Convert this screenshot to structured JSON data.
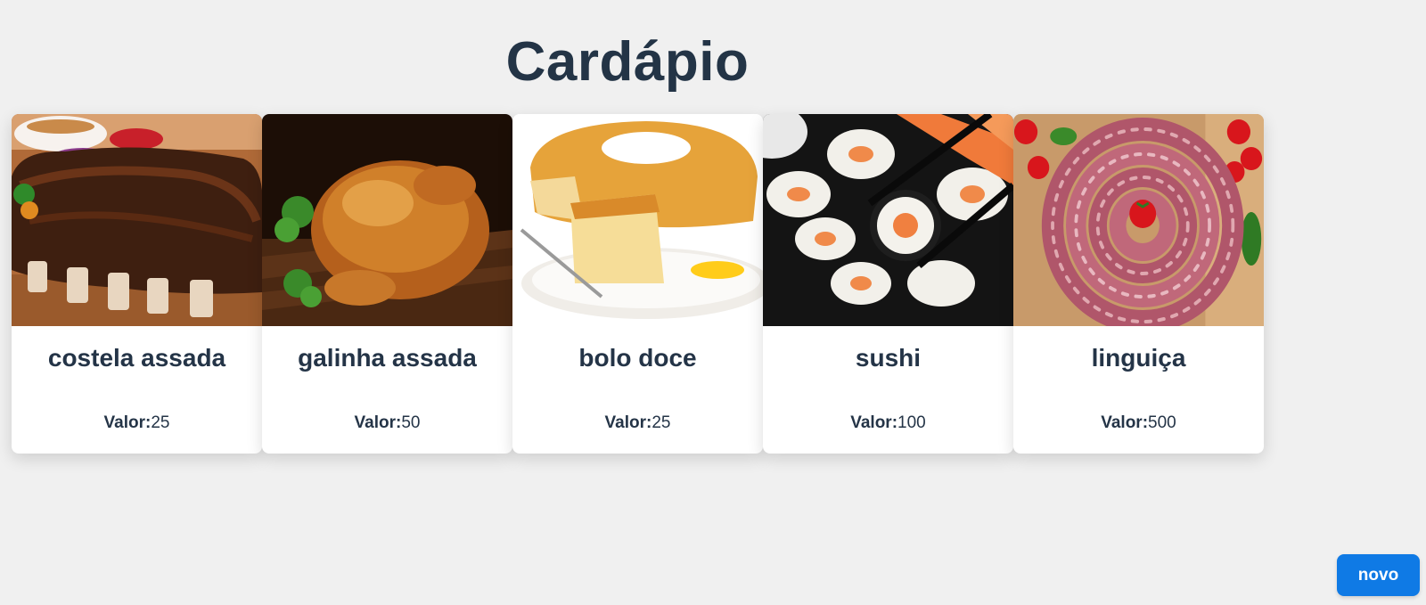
{
  "page": {
    "title": "Cardápio",
    "background": "#f0f0f0",
    "text_color": "#243447"
  },
  "menu": {
    "price_label": "Valor:",
    "items": [
      {
        "name": "costela assada",
        "price": "25",
        "image": "ribs-photo"
      },
      {
        "name": "galinha assada",
        "price": "50",
        "image": "roast-chicken-photo"
      },
      {
        "name": "bolo doce",
        "price": "25",
        "image": "sweet-cake-photo"
      },
      {
        "name": "sushi",
        "price": "100",
        "image": "sushi-photo"
      },
      {
        "name": "linguiça",
        "price": "500",
        "image": "sausage-photo"
      }
    ]
  },
  "actions": {
    "new_label": "novo",
    "new_color": "#0f7ae5"
  }
}
